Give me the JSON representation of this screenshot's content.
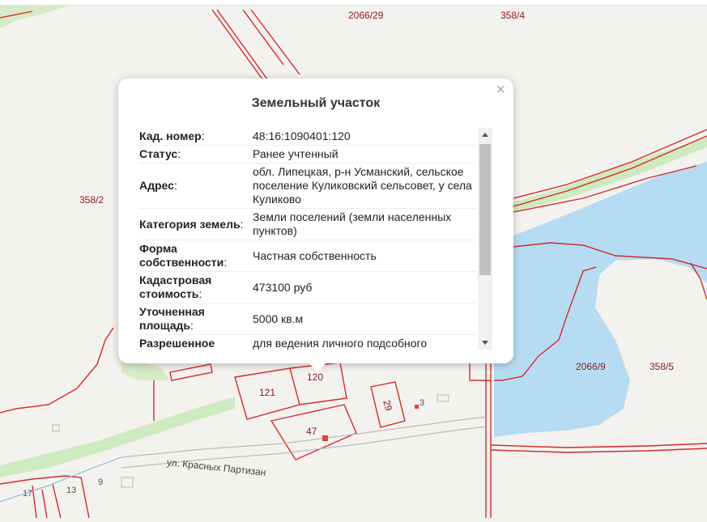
{
  "map": {
    "parcel_labels": [
      {
        "id": "lbl-2066-29",
        "text": "2066/29"
      },
      {
        "id": "lbl-358-4",
        "text": "358/4"
      },
      {
        "id": "lbl-358-2",
        "text": "358/2"
      },
      {
        "id": "lbl-2066-9",
        "text": "2066/9"
      },
      {
        "id": "lbl-358-5",
        "text": "358/5"
      },
      {
        "id": "lbl-121",
        "text": "121"
      },
      {
        "id": "lbl-120",
        "text": "120"
      },
      {
        "id": "lbl-29",
        "text": "29"
      },
      {
        "id": "lbl-3",
        "text": "3"
      },
      {
        "id": "lbl-47",
        "text": "47"
      },
      {
        "id": "lbl-17",
        "text": "17"
      },
      {
        "id": "lbl-13",
        "text": "13"
      },
      {
        "id": "lbl-9",
        "text": "9"
      }
    ],
    "street_name": "ул. Красных Партизан",
    "colors": {
      "boundary": "#d42a2a",
      "water": "#b6dcf3",
      "greenery": "#cfeac0",
      "background": "#f4f2ee"
    }
  },
  "popup": {
    "title": "Земельный участок",
    "close_symbol": "×",
    "rows": [
      {
        "key": "Кад. номер",
        "value": "48:16:1090401:120"
      },
      {
        "key": "Статус",
        "value": "Ранее учтенный"
      },
      {
        "key": "Адрес",
        "value": "обл. Липецкая, р-н Усманский, сельское поселение Куликовский сельсовет, у села Куликово"
      },
      {
        "key": "Категория земель",
        "value": "Земли поселений (земли населенных пунктов)"
      },
      {
        "key": "Форма собственности",
        "value": "Частная собственность"
      },
      {
        "key": "Кадастровая стоимость",
        "value": "473100 руб"
      },
      {
        "key": "Уточненная площадь",
        "value": "5000 кв.м"
      },
      {
        "key": "Разрешенное",
        "value": "для ведения личного подсобного"
      }
    ]
  }
}
